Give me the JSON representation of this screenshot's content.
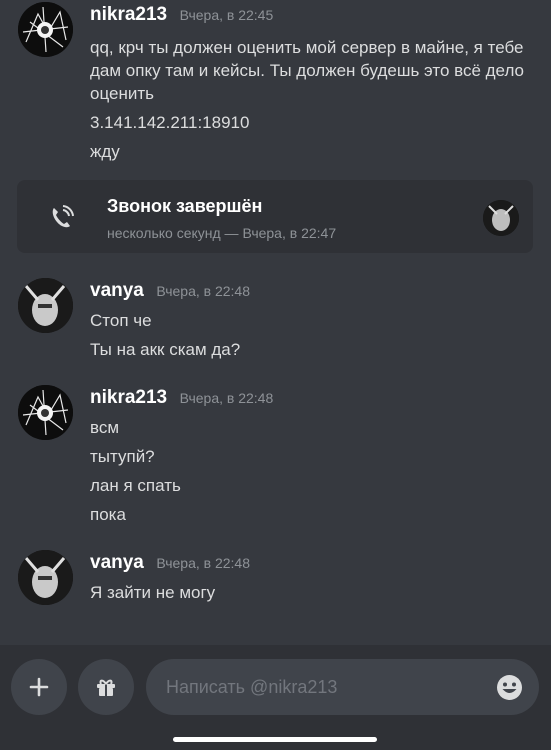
{
  "messages": [
    {
      "username": "nikra213",
      "timestamp": "Вчера, в 22:45",
      "lines": [
        "qq, крч ты должен оценить мой сервер в майне, я тебе дам опку там и кейсы. Ты должен будешь это всё дело оценить",
        "3.141.142.211:18910",
        "жду"
      ]
    },
    {
      "username": "vanya",
      "timestamp": "Вчера, в 22:48",
      "lines": [
        "Стоп че",
        "Ты на акк скам да?"
      ]
    },
    {
      "username": "nikra213",
      "timestamp": "Вчера, в 22:48",
      "lines": [
        "всм",
        "тытупй?",
        "лан я спать",
        "пока"
      ]
    },
    {
      "username": "vanya",
      "timestamp": "Вчера, в 22:48",
      "lines": [
        "Я зайти не могу"
      ]
    }
  ],
  "call": {
    "title": "Звонок завершён",
    "subtitle": "несколько секунд — Вчера, в 22:47",
    "icon": "phone-ended-icon"
  },
  "composer": {
    "placeholder": "Написать @nikra213",
    "value": "",
    "add_icon": "plus-icon",
    "gift_icon": "gift-icon",
    "emoji_icon": "emoji-icon"
  },
  "colors": {
    "background": "#36393f",
    "card": "#2f3136",
    "username": "#ffffff",
    "timestamp": "#8e9297",
    "text": "#dcddde"
  }
}
